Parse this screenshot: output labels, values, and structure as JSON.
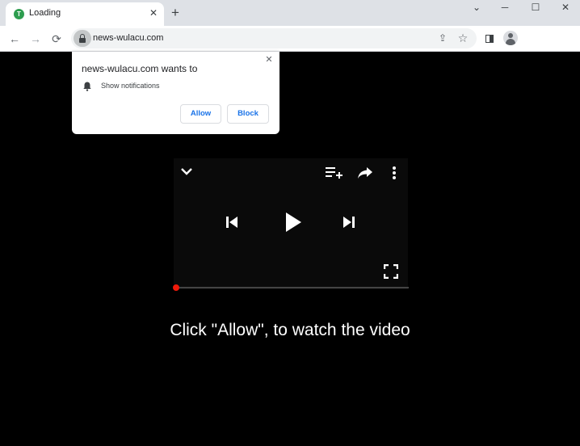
{
  "tab": {
    "title": "Loading",
    "favicon_letter": "T",
    "close_glyph": "✕"
  },
  "new_tab_glyph": "+",
  "window_controls": {
    "minimize": "⌄",
    "restore": "─",
    "maximize": "☐",
    "close": "✕"
  },
  "toolbar": {
    "back_glyph": "←",
    "forward_glyph": "→",
    "reload_glyph": "⟳",
    "url": "news-wulacu.com",
    "share_glyph": "⇪",
    "star_glyph": "☆"
  },
  "popup": {
    "title": "news-wulacu.com wants to",
    "permission": "Show notifications",
    "allow_label": "Allow",
    "block_label": "Block",
    "close_glyph": "✕"
  },
  "player": {
    "progress": 0
  },
  "cta_text": "Click \"Allow\", to watch the video",
  "colors": {
    "tabstrip": "#dee1e6",
    "page_bg": "#000000",
    "accent_blue": "#1a73e8",
    "progress_red": "#f01a0a",
    "favicon_green": "#2e9d4f"
  }
}
